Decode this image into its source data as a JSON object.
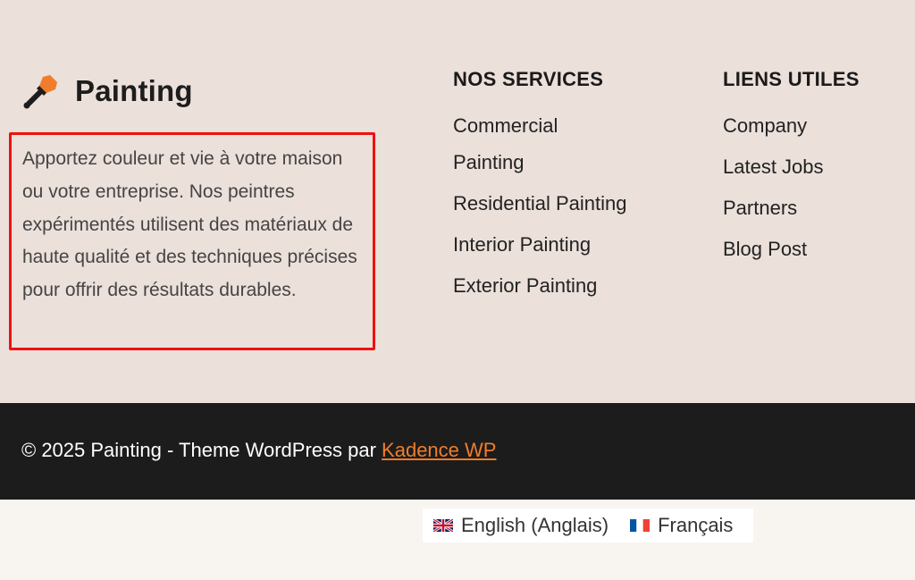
{
  "brand": {
    "name": "Painting",
    "icon": "paint-brush-icon"
  },
  "about": {
    "description": "Apportez couleur et vie à votre maison ou votre entreprise. Nos peintres expérimentés utilisent des matériaux de haute qualité et des techniques précises pour offrir des résultats durables."
  },
  "services": {
    "title": "NOS SERVICES",
    "items": [
      {
        "label": "Commercial Painting"
      },
      {
        "label": "Residential Painting"
      },
      {
        "label": "Interior Painting"
      },
      {
        "label": "Exterior Painting"
      }
    ]
  },
  "useful_links": {
    "title": "LIENS UTILES",
    "items": [
      {
        "label": "Company"
      },
      {
        "label": "Latest Jobs"
      },
      {
        "label": "Partners"
      },
      {
        "label": "Blog Post"
      }
    ]
  },
  "footer": {
    "copyright_prefix": "© 2025 Painting - Theme WordPress par ",
    "theme_link": "Kadence WP"
  },
  "languages": [
    {
      "label": "English (Anglais)",
      "flag": "uk-flag-icon"
    },
    {
      "label": "Français",
      "flag": "fr-flag-icon"
    }
  ],
  "colors": {
    "footer_bg": "#ebe0da",
    "bottom_bar_bg": "#1c1c1c",
    "accent": "#f07d2b",
    "highlight_border": "#ee1111"
  }
}
